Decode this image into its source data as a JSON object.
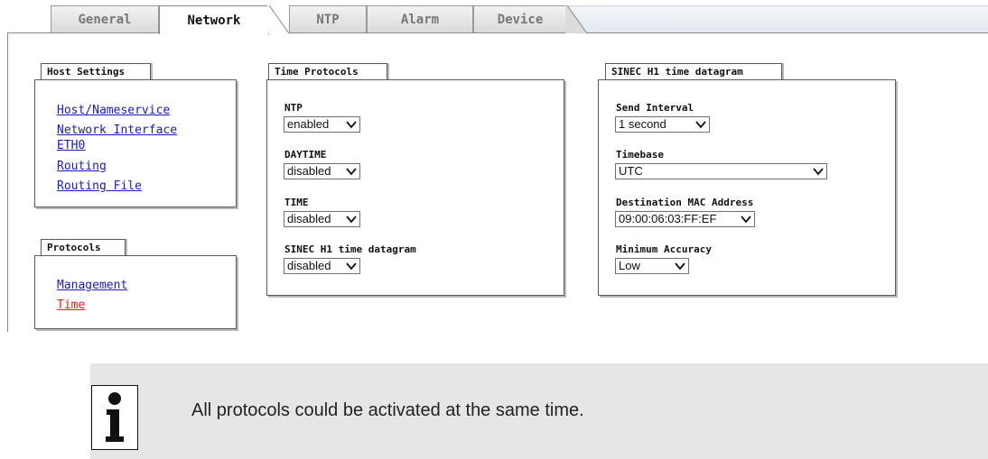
{
  "tabs": [
    {
      "label": "General",
      "active": false
    },
    {
      "label": "Network",
      "active": true
    },
    {
      "label": "NTP",
      "active": false
    },
    {
      "label": "Alarm",
      "active": false
    },
    {
      "label": "Device",
      "active": false
    }
  ],
  "host_settings": {
    "title": "Host Settings",
    "links": [
      "Host/Nameservice",
      "Network Interface",
      "ETH0",
      "Routing",
      "Routing File"
    ]
  },
  "protocols": {
    "title": "Protocols",
    "links": [
      "Management",
      "Time"
    ],
    "current": "Time"
  },
  "time_protocols": {
    "title": "Time Protocols",
    "fields": [
      {
        "label": "NTP",
        "value": "enabled"
      },
      {
        "label": "DAYTIME",
        "value": "disabled"
      },
      {
        "label": "TIME",
        "value": "disabled"
      },
      {
        "label": "SINEC H1 time datagram",
        "value": "disabled"
      }
    ]
  },
  "sinec": {
    "title": "SINEC H1 time datagram",
    "fields": [
      {
        "label": "Send Interval",
        "value": "1 second"
      },
      {
        "label": "Timebase",
        "value": "UTC"
      },
      {
        "label": "Destination MAC Address",
        "value": "09:00:06:03:FF:EF"
      },
      {
        "label": "Minimum Accuracy",
        "value": "Low"
      }
    ]
  },
  "info": {
    "icon": "info-icon",
    "text": "All protocols could be activated at the same time."
  },
  "colors": {
    "link": "#1a1ac0",
    "current_link": "#e0201e",
    "info_bg": "#e6e6e6"
  }
}
